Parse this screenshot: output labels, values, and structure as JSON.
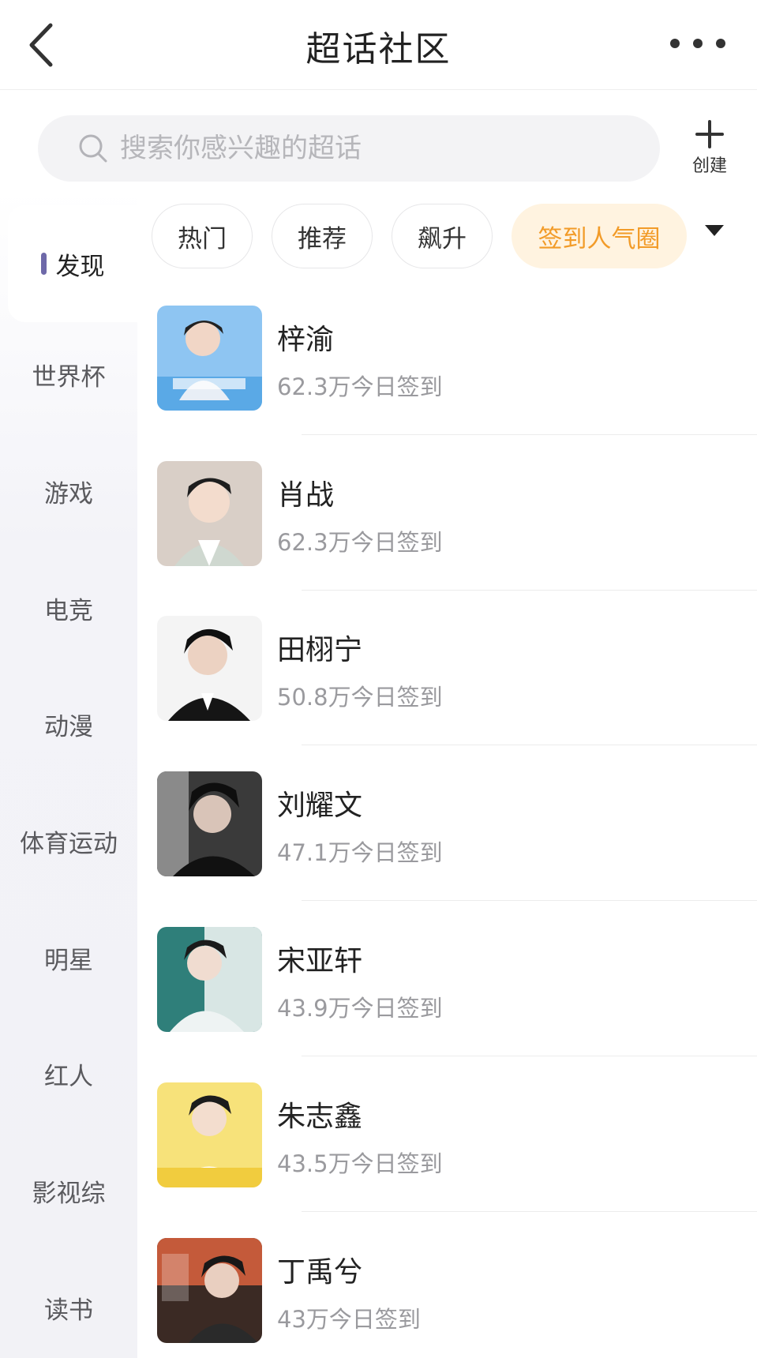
{
  "header": {
    "title": "超话社区"
  },
  "search": {
    "placeholder": "搜索你感兴趣的超话"
  },
  "create": {
    "label": "创建"
  },
  "sidebar": {
    "items": [
      {
        "label": "发现",
        "active": true
      },
      {
        "label": "世界杯"
      },
      {
        "label": "游戏"
      },
      {
        "label": "电竞"
      },
      {
        "label": "动漫"
      },
      {
        "label": "体育运动"
      },
      {
        "label": "明星"
      },
      {
        "label": "红人"
      },
      {
        "label": "影视综"
      },
      {
        "label": "读书"
      }
    ]
  },
  "chips": [
    {
      "label": "热门"
    },
    {
      "label": "推荐"
    },
    {
      "label": "飙升"
    },
    {
      "label": "签到人气圈",
      "active": true
    }
  ],
  "colors": {
    "accent_orange": "#f29b28",
    "chip_active_bg": "#fff3e0",
    "sidebar_indicator": "#6e69a9"
  },
  "list": [
    {
      "name": "梓渝",
      "stat": "62.3万今日签到"
    },
    {
      "name": "肖战",
      "stat": "62.3万今日签到"
    },
    {
      "name": "田栩宁",
      "stat": "50.8万今日签到"
    },
    {
      "name": "刘耀文",
      "stat": "47.1万今日签到"
    },
    {
      "name": "宋亚轩",
      "stat": "43.9万今日签到"
    },
    {
      "name": "朱志鑫",
      "stat": "43.5万今日签到"
    },
    {
      "name": "丁禹兮",
      "stat": "43万今日签到"
    }
  ]
}
